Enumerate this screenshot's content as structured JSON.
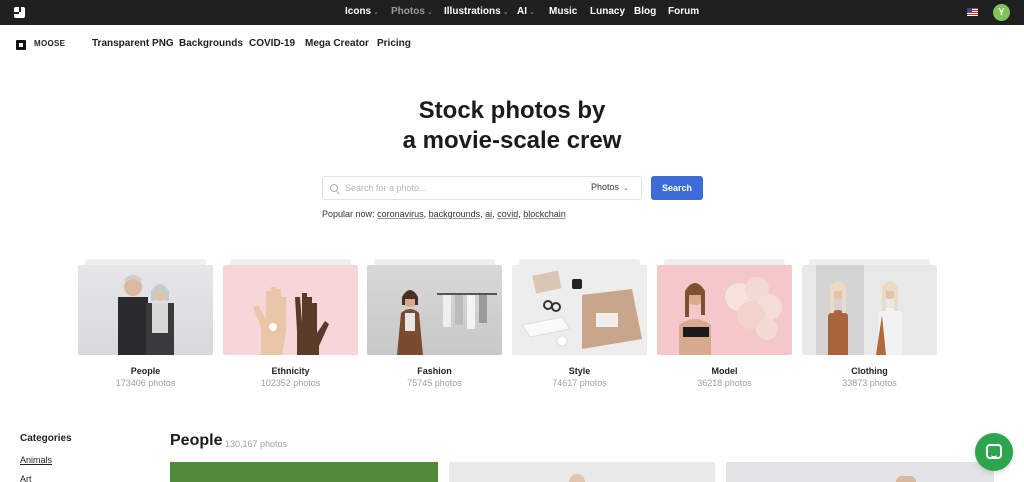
{
  "topnav": {
    "items": [
      {
        "label": "Icons",
        "has_menu": true
      },
      {
        "label": "Photos",
        "has_menu": true,
        "active": true
      },
      {
        "label": "Illustrations",
        "has_menu": true
      },
      {
        "label": "AI",
        "has_menu": true
      },
      {
        "label": "Music",
        "has_menu": false
      },
      {
        "label": "Lunacy",
        "has_menu": false
      },
      {
        "label": "Blog",
        "has_menu": false
      },
      {
        "label": "Forum",
        "has_menu": false
      }
    ],
    "avatar_initial": "Y"
  },
  "subnav": {
    "brand": "MOOSE",
    "links": [
      "Transparent PNG",
      "Backgrounds",
      "COVID-19",
      "Mega Creator",
      "Pricing"
    ]
  },
  "hero": {
    "title_line1": "Stock photos by",
    "title_line2": "a movie-scale crew"
  },
  "search": {
    "placeholder": "Search for a photo...",
    "type_value": "Photos",
    "button_label": "Search",
    "accent_color": "#3d6bd8"
  },
  "popular": {
    "prefix": "Popular now:",
    "tags": [
      "coronavirus",
      "backgrounds",
      "ai",
      "covid",
      "blockchain"
    ]
  },
  "categories_cards": [
    {
      "name": "People",
      "count": "173406 photos"
    },
    {
      "name": "Ethnicity",
      "count": "102352 photos"
    },
    {
      "name": "Fashion",
      "count": "75745 photos"
    },
    {
      "name": "Style",
      "count": "74617 photos"
    },
    {
      "name": "Model",
      "count": "36218 photos"
    },
    {
      "name": "Clothing",
      "count": "33873 photos"
    }
  ],
  "sidebar": {
    "heading": "Categories",
    "items": [
      "Animals",
      "Art"
    ]
  },
  "section": {
    "title": "People",
    "count": "130,167 photos"
  }
}
